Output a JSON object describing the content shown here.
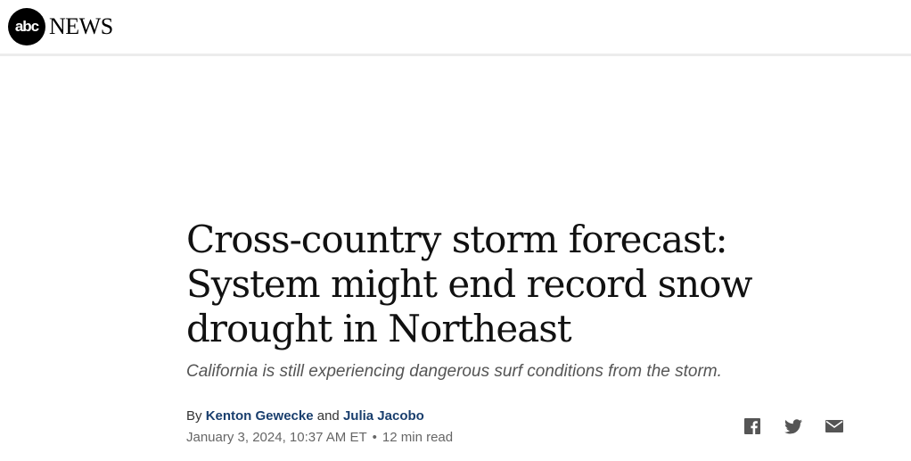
{
  "site": {
    "logo_mark": "abc",
    "logo_text": "NEWS"
  },
  "article": {
    "headline": "Cross-country storm forecast: System might end record snow drought in Northeast",
    "subheadline": "California is still experiencing dangerous surf conditions from the storm.",
    "byline_prefix": "By",
    "byline_joiner": "and",
    "authors": [
      "Kenton Gewecke",
      "Julia Jacobo"
    ],
    "timestamp": "January 3, 2024, 10:37 AM ET",
    "separator": "•",
    "read_time": "12 min read"
  },
  "share": {
    "icons": [
      "facebook-icon",
      "twitter-icon",
      "email-icon"
    ]
  },
  "colors": {
    "author_link": "#1a3f6e",
    "divider": "#ececec",
    "icon": "#555555"
  }
}
